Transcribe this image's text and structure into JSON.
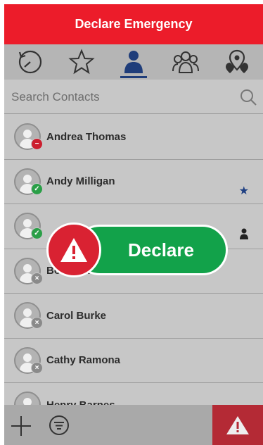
{
  "header": {
    "title": "Declare Emergency"
  },
  "tabs": [
    {
      "icon": "history-icon"
    },
    {
      "icon": "star-icon"
    },
    {
      "icon": "person-icon",
      "active": true
    },
    {
      "icon": "group-icon"
    },
    {
      "icon": "locations-icon"
    }
  ],
  "search": {
    "placeholder": "Search Contacts",
    "icon": "search-icon"
  },
  "contacts": [
    {
      "name": "Andrea Thomas",
      "status": "do-not-disturb"
    },
    {
      "name": "Andy Milligan",
      "status": "available",
      "mark": "favorite-star"
    },
    {
      "name": "",
      "status": "available",
      "mark": "person"
    },
    {
      "name": "Bob Harris",
      "status": "offline"
    },
    {
      "name": "Carol Burke",
      "status": "offline"
    },
    {
      "name": "Cathy Ramona",
      "status": "offline"
    },
    {
      "name": "Henry Barnes",
      "status": "offline"
    }
  ],
  "overlay": {
    "button_label": "Declare"
  },
  "footer": {
    "add_icon": "plus-icon",
    "filter_icon": "filter-icon",
    "declare_icon": "alert-triangle-icon"
  },
  "colors": {
    "brand_red": "#ec1c2a",
    "declare_green": "#12a24a",
    "nav_blue": "#1f3d7a"
  }
}
